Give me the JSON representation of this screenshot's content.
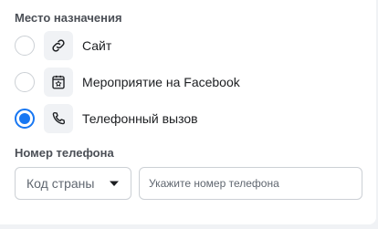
{
  "destination": {
    "title": "Место назначения",
    "options": [
      {
        "label": "Сайт",
        "icon": "link-icon",
        "selected": false
      },
      {
        "label": "Мероприятие на Facebook",
        "icon": "calendar-star-icon",
        "selected": false
      },
      {
        "label": "Телефонный вызов",
        "icon": "phone-icon",
        "selected": true
      }
    ]
  },
  "phone": {
    "title": "Номер телефона",
    "country_code_label": "Код страны",
    "number_placeholder": "Укажите номер телефона",
    "number_value": ""
  },
  "colors": {
    "accent": "#1877f2",
    "border": "#ccd0d5",
    "icon_bg": "#f0f2f5",
    "text": "#1c1e21",
    "muted": "#606770"
  }
}
